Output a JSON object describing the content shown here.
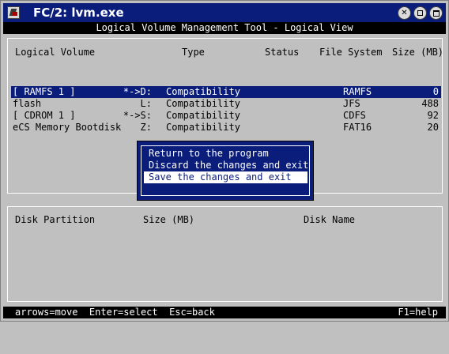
{
  "window": {
    "title": "FC/2: lvm.exe"
  },
  "header": {
    "title": "Logical Volume Management Tool - Logical View"
  },
  "volumes": {
    "columns": {
      "name": "Logical Volume",
      "type": "Type",
      "status": "Status",
      "fs": "File System",
      "size": "Size (MB)"
    },
    "rows": [
      {
        "name": "[ RAMFS 1 ]",
        "drive": "*->D:",
        "type": "Compatibility",
        "status": "",
        "fs": "RAMFS",
        "size": "0",
        "selected": true
      },
      {
        "name": "flash",
        "drive": "L:",
        "type": "Compatibility",
        "status": "",
        "fs": "JFS",
        "size": "488",
        "selected": false
      },
      {
        "name": "[ CDROM 1 ]",
        "drive": "*->S:",
        "type": "Compatibility",
        "status": "",
        "fs": "CDFS",
        "size": "92",
        "selected": false
      },
      {
        "name": "eCS Memory Bootdisk",
        "drive": "Z:",
        "type": "Compatibility",
        "status": "",
        "fs": "FAT16",
        "size": "20",
        "selected": false
      }
    ]
  },
  "partitions": {
    "columns": {
      "partition": "Disk Partition",
      "size": "Size (MB)",
      "disk": "Disk Name"
    }
  },
  "menu": {
    "items": [
      {
        "label": "Return to the program",
        "selected": false
      },
      {
        "label": "Discard the changes and exit",
        "selected": false
      },
      {
        "label": "Save the changes and exit",
        "selected": true
      }
    ]
  },
  "footer": {
    "left": "arrows=move  Enter=select  Esc=back",
    "right": "F1=help"
  },
  "colors": {
    "accent": "#0a1d7a",
    "background": "#c0c0c0",
    "bar": "#000000"
  }
}
